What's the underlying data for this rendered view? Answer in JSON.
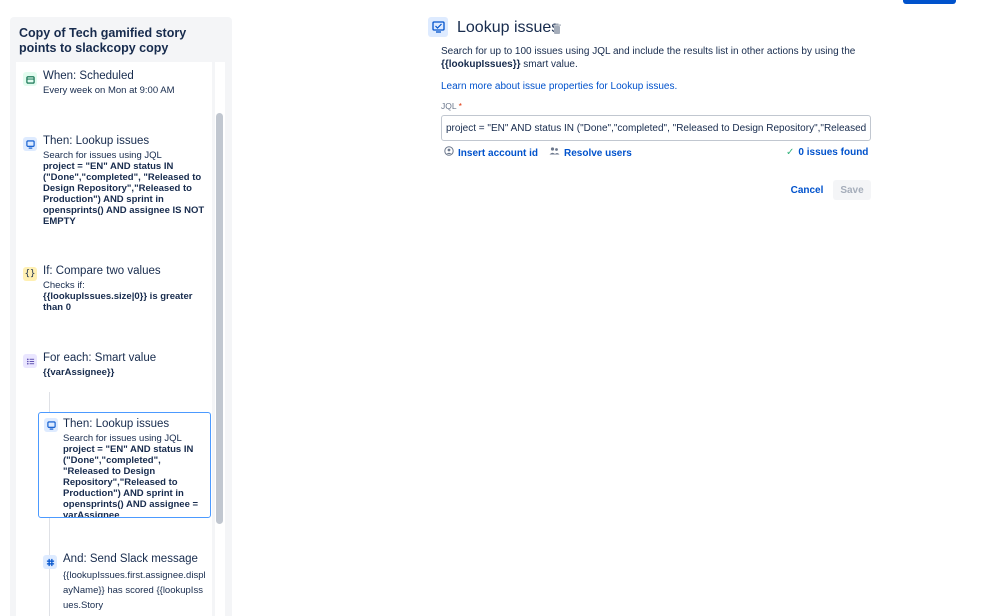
{
  "rule": {
    "title": "Copy of Tech gamified story points to slackcopy copy"
  },
  "components": [
    {
      "title": "When: Scheduled",
      "desc_plain": "Every week on Mon at 9:00 AM",
      "icon": "calendar-icon"
    },
    {
      "title": "Then: Lookup issues",
      "desc_plain": "Search for issues using JQL",
      "desc_bold": "project = \"EN\" AND status IN (\"Done\",\"completed\", \"Released to Design Repository\",\"Released to Production\") AND sprint in opensprints() AND assignee IS NOT EMPTY",
      "icon": "lookup-icon"
    },
    {
      "title": "If: Compare two values",
      "desc_plain": "Checks if:",
      "desc_bold": "{{lookupIssues.size|0}} is greater than 0",
      "icon": "braces-icon",
      "icon_glyph": "{}"
    },
    {
      "title": "For each: Smart value",
      "desc_bold": "{{varAssignee}}",
      "icon": "list-icon"
    },
    {
      "title": "Then: Lookup issues",
      "desc_plain": "Search for issues using JQL",
      "desc_bold": "project = \"EN\" AND status IN (\"Done\",\"completed\", \"Released to Design Repository\",\"Released to Production\") AND sprint in opensprints() AND assignee = varAssignee",
      "icon": "lookup-icon"
    },
    {
      "title": "And: Send Slack message",
      "desc_plain": "{{lookupIssues.first.assignee.displayName}} has scored {{lookupIssues.Story",
      "icon": "slack-icon"
    }
  ],
  "panel": {
    "title": "Lookup issues",
    "desc_prefix": "Search for up to 100 issues using JQL and include the results list in other actions by using the",
    "desc_smart": "{{lookupIssues}}",
    "desc_suffix": " smart value.",
    "learn_link": "Learn more about issue properties for Lookup issues.",
    "jql_label": "JQL",
    "jql_required": "*",
    "jql_value": "project = \"EN\" AND status IN (\"Done\",\"completed\", \"Released to Design Repository\",\"Released to Production\") AND sprint in opensprints() AND assignee IS NOT EMPTY",
    "insert_account": "Insert account id",
    "resolve_users": "Resolve users",
    "issues_found": "0 issues found",
    "cancel": "Cancel",
    "save": "Save"
  },
  "colors": {
    "accent": "#0052cc",
    "selected_border": "#4c9aff",
    "success": "#36b37e",
    "required": "#de350b"
  }
}
